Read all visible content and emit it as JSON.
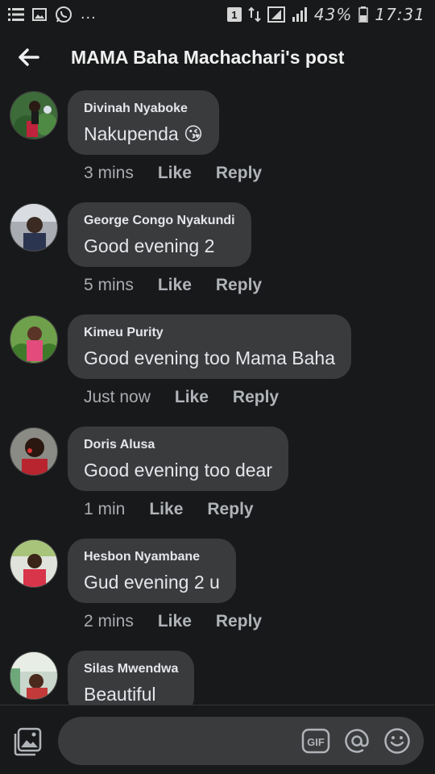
{
  "status_bar": {
    "dots": "...",
    "sim_badge": "1",
    "battery_pct": "43%",
    "time": "17:31"
  },
  "header": {
    "title": "MAMA Baha Machachari's post"
  },
  "comments": [
    {
      "name": "Divinah Nyaboke",
      "text": "Nakupenda 😘",
      "time": "3 mins",
      "like": "Like",
      "reply": "Reply"
    },
    {
      "name": "George Congo Nyakundi",
      "text": "Good evening 2",
      "time": "5 mins",
      "like": "Like",
      "reply": "Reply"
    },
    {
      "name": "Kimeu Purity",
      "text": "Good evening too Mama Baha",
      "time": "Just now",
      "like": "Like",
      "reply": "Reply"
    },
    {
      "name": "Doris Alusa",
      "text": "Good evening too dear",
      "time": "1 min",
      "like": "Like",
      "reply": "Reply"
    },
    {
      "name": "Hesbon Nyambane",
      "text": "Gud evening 2 u",
      "time": "2 mins",
      "like": "Like",
      "reply": "Reply"
    },
    {
      "name": "Silas Mwendwa",
      "text": "Beautiful"
    }
  ],
  "composer": {
    "gif_label": "GIF"
  },
  "icons": {
    "back": "arrow-left-icon",
    "photo": "photo-icon",
    "gif": "gif-icon",
    "mention": "at-icon",
    "emoji": "smiley-icon"
  }
}
